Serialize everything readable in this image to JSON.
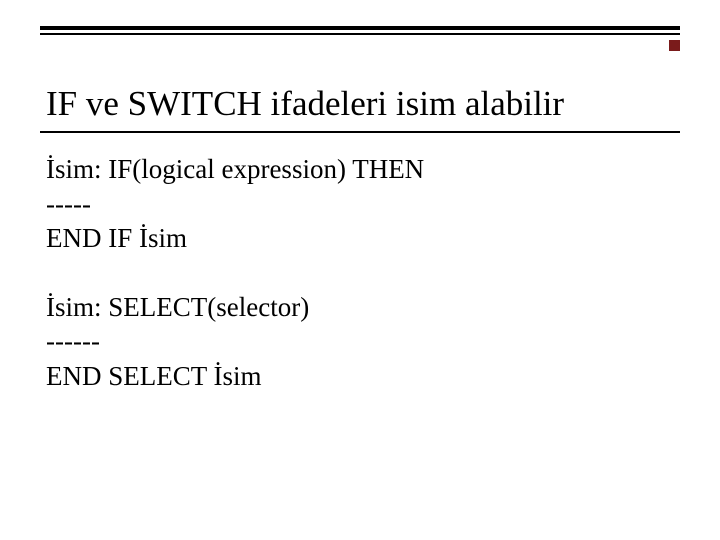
{
  "title": "IF ve SWITCH ifadeleri isim alabilir",
  "block1": {
    "l1": "İsim: IF(logical expression) THEN",
    "l2": "-----",
    "l3": "END IF İsim"
  },
  "block2": {
    "l1": "İsim: SELECT(selector)",
    "l2": "------",
    "l3": "END SELECT İsim"
  }
}
